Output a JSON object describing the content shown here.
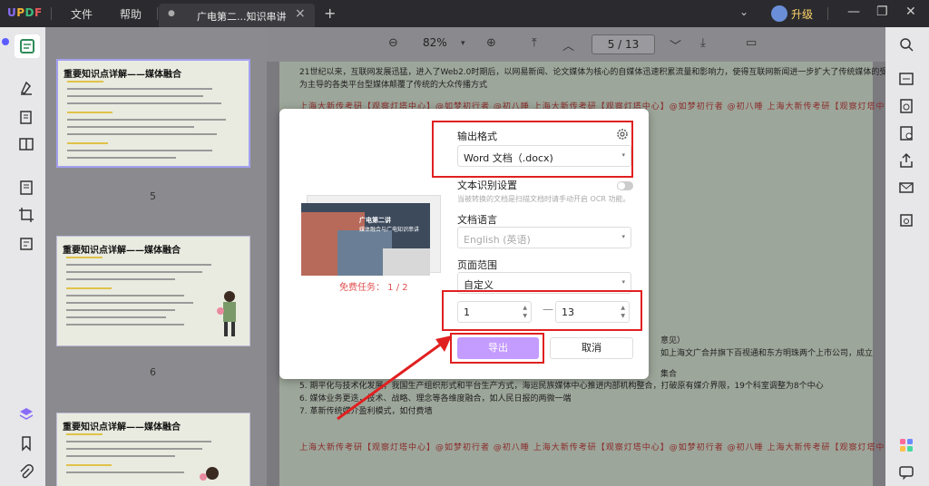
{
  "app": {
    "logo": {
      "u": "U",
      "p": "P",
      "d": "D",
      "f": "F"
    },
    "menu": [
      "文件",
      "帮助"
    ],
    "tab_label": "广电第二...知识串讲",
    "tab_close": "×",
    "tab_add": "+",
    "upgrade_label": "升级",
    "window_controls": {
      "minimize": "—",
      "restore": "❐",
      "close": "✕"
    }
  },
  "toolbar": {
    "zoom_out": "⊖",
    "zoom_value": "82%",
    "zoom_dropdown": "▾",
    "zoom_in": "⊕",
    "first_page": "⤒",
    "prev_page": "︿",
    "page_indicator": "5 / 13",
    "next_page": "﹀",
    "last_page": "⤓",
    "comment": "▭"
  },
  "thumbnails": [
    {
      "heading": "重要知识点详解——媒体融合",
      "page": "5"
    },
    {
      "heading": "重要知识点详解——媒体融合",
      "page": "6"
    },
    {
      "heading": "重要知识点详解——媒体融合",
      "page": ""
    }
  ],
  "document": {
    "top_line": "21世纪以来，互联网发展迅猛，进入了Web2.0时期后，以网易新闻、论文媒体为核心的自媒体迅速积累流量和影响力，使得互联网新闻进一步扩大了传统媒体的受众，以移动终",
    "top_line2": "为主导的各类平台型媒体颠覆了传统的大众传播方式",
    "watermark": "上海大新传考研【观察灯塔中心】@如梦初行者 @初八睡    上海大新传考研【观察灯塔中心】@如梦初行者 @初八睡    上海大新传考研【观察灯塔中",
    "body_lines": [
      "5. 期平化与技术化发展，我国生产组织形式和平台生产方式，海运民族媒体中心推进内部机构整合，打破原有媒介界限，19个科室调整为8个中心",
      "6. 媒体业务更迭，技术、战略、理念等各维度融合，如人民日报的两微一端",
      "7. 革新传统媒介盈利模式，如付费墙"
    ],
    "right_frag1": "意见）",
    "right_frag2": "如上海文广合并旗下百视通和东方明珠两个上市公司，成立",
    "right_frag3": "集合"
  },
  "dialog": {
    "output_format_label": "输出格式",
    "output_format_value": "Word 文档（.docx)",
    "ocr_label": "文本识别设置",
    "ocr_hint": "当被转换的文档是扫描文档时请手动开启 OCR 功能。",
    "doc_language_label": "文档语言",
    "doc_language_value": "English (英语)",
    "page_range_label": "页面范围",
    "page_range_value": "自定义",
    "range_from": "1",
    "range_to": "13",
    "range_dash": "—",
    "free_task": "免费任务：  1 / 2",
    "preview_title": "广电第二讲",
    "preview_subtitle": "媒体融合与广电知识串讲",
    "export_label": "导出",
    "cancel_label": "取消",
    "select_arrow": "▾",
    "spin": "▲▼"
  },
  "colors": {
    "accent": "#c49bff",
    "annotation_red": "#e02020",
    "free_task": "#e05050"
  }
}
